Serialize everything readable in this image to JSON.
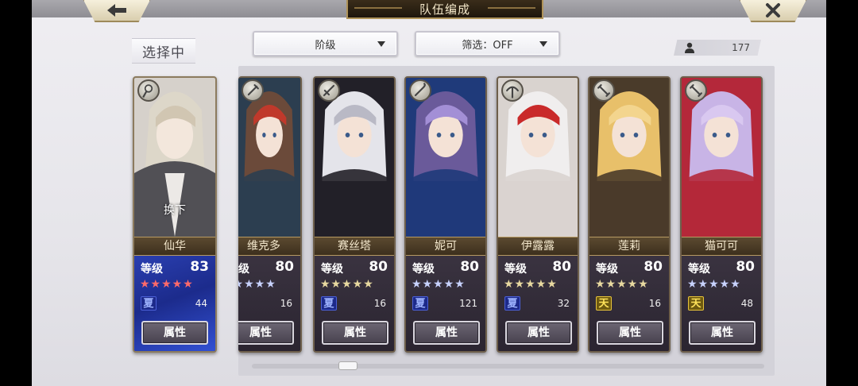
{
  "header": {
    "title": "队伍编成",
    "back_icon": "back-arrow-icon",
    "close_icon": "close-x-icon"
  },
  "selecting_label": "选择中",
  "filters": {
    "sort_label": "阶级",
    "filter_label": "筛选：OFF"
  },
  "roster_count": "177",
  "selected_card": {
    "name": "仙华",
    "level_label": "等级",
    "level": "83",
    "stars": "★★★★★",
    "rank": "夏",
    "count": "44",
    "attr_label": "属性",
    "swap_label": "换下",
    "star_color": "#ff6a6a"
  },
  "cards": [
    {
      "name": "维克多",
      "level_label": "等级",
      "level": "80",
      "stars": "★★★★★",
      "star_color": "#c8d2ff",
      "rank": "夏",
      "rank_style": "blue",
      "count": "16",
      "attr_label": "属性"
    },
    {
      "name": "赛丝塔",
      "level_label": "等级",
      "level": "80",
      "stars": "★★★★★",
      "star_color": "#e8d9a0",
      "rank": "夏",
      "rank_style": "blue",
      "count": "16",
      "attr_label": "属性"
    },
    {
      "name": "妮可",
      "level_label": "等级",
      "level": "80",
      "stars": "★★★★★",
      "star_color": "#c8d2ff",
      "rank": "夏",
      "rank_style": "blue",
      "count": "121",
      "attr_label": "属性"
    },
    {
      "name": "伊露露",
      "level_label": "等级",
      "level": "80",
      "stars": "★★★★★",
      "star_color": "#e8d9a0",
      "rank": "夏",
      "rank_style": "blue",
      "count": "32",
      "attr_label": "属性"
    },
    {
      "name": "莲莉",
      "level_label": "等级",
      "level": "80",
      "stars": "★★★★★",
      "star_color": "#e8d9a0",
      "rank": "天",
      "rank_style": "gold",
      "count": "16",
      "attr_label": "属性"
    },
    {
      "name": "猫可可",
      "level_label": "等级",
      "level": "80",
      "stars": "★★★★★",
      "star_color": "#c8d2ff",
      "rank": "天",
      "rank_style": "gold",
      "count": "48",
      "attr_label": "属性"
    }
  ],
  "colors": {
    "accent_gold": "#b0945a",
    "panel": "#d3d2d9",
    "selected_blue": "#2a3fb0"
  }
}
